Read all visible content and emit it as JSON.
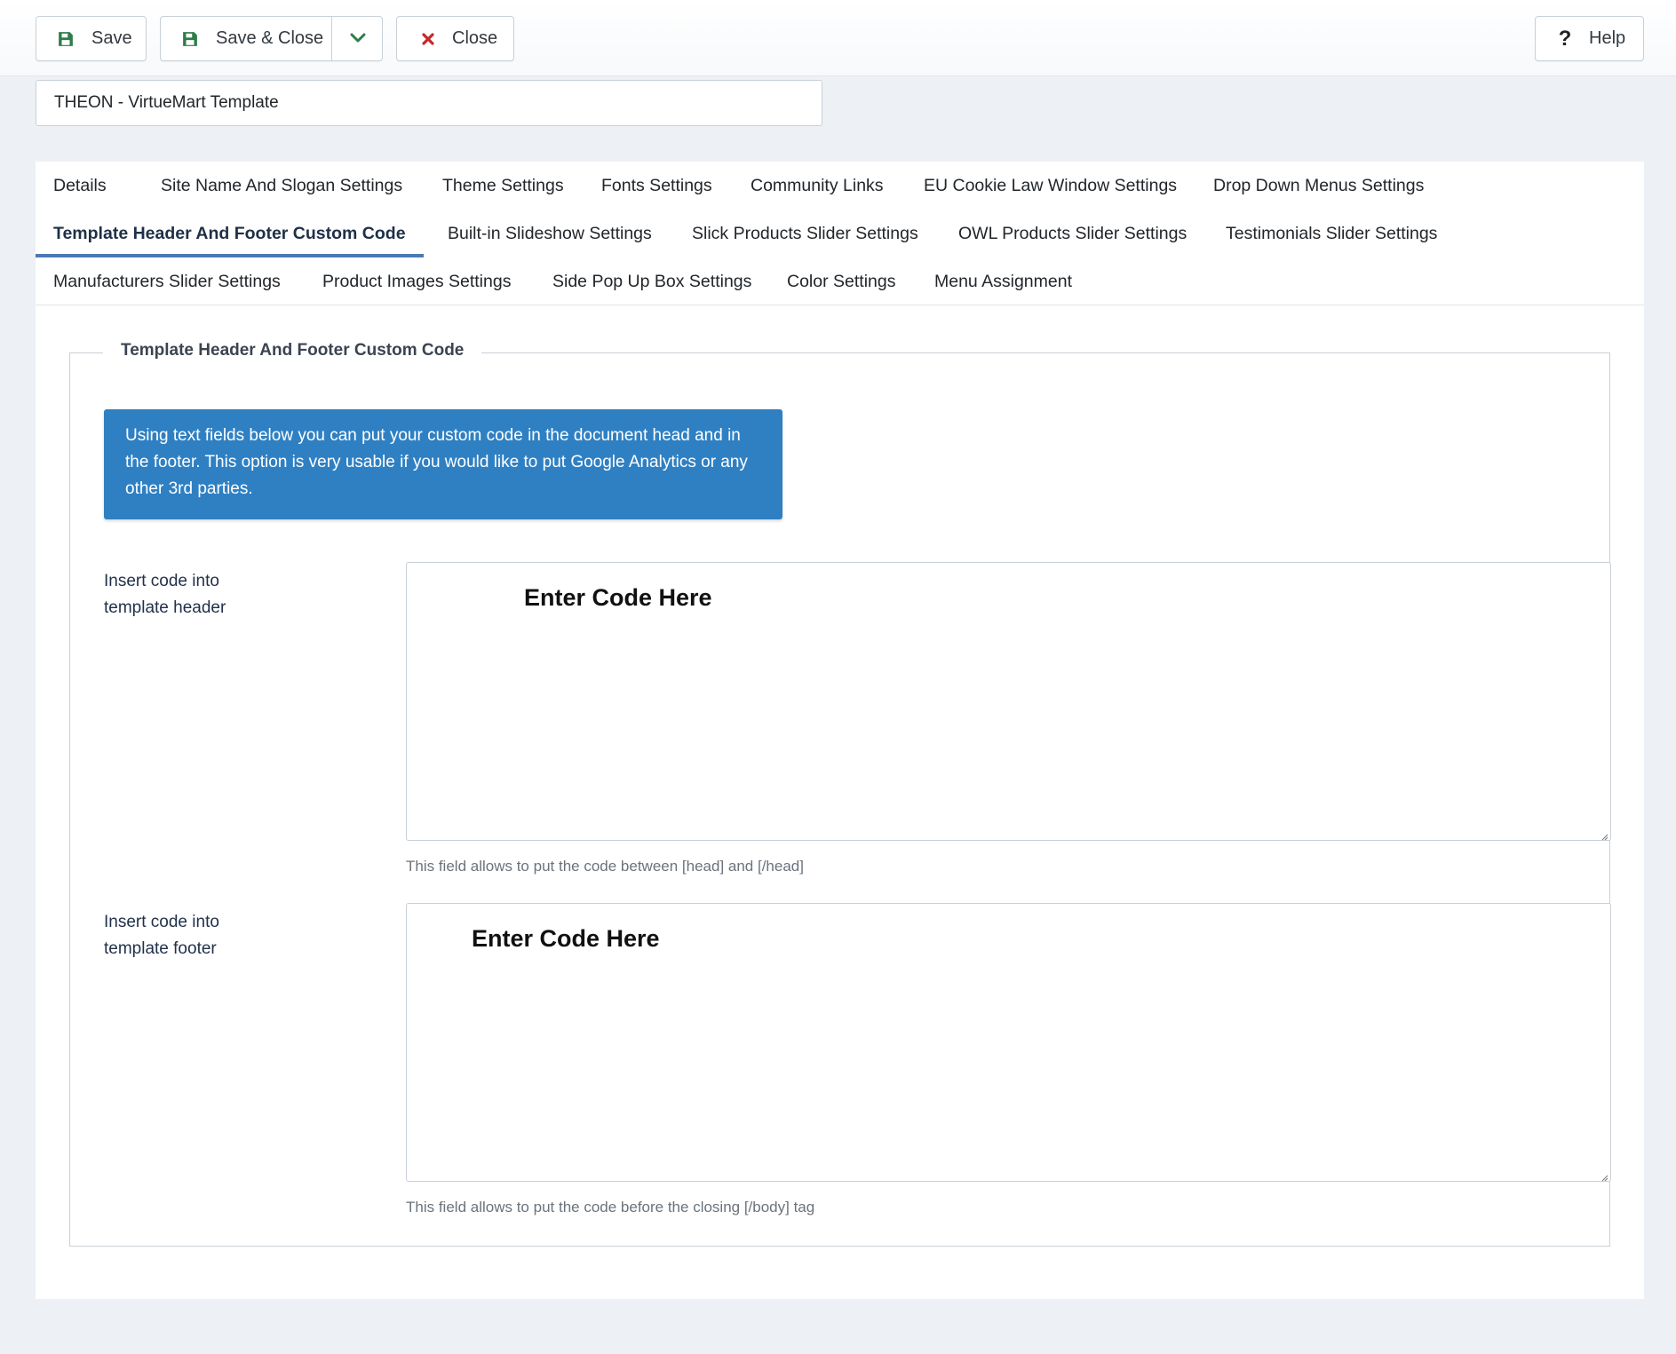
{
  "toolbar": {
    "save_label": "Save",
    "save_close_label": "Save & Close",
    "close_label": "Close",
    "help_label": "Help"
  },
  "title": {
    "value": "THEON - VirtueMart Template"
  },
  "tabs": [
    {
      "label": "Details"
    },
    {
      "label": "Site Name And Slogan Settings"
    },
    {
      "label": "Theme Settings"
    },
    {
      "label": "Fonts Settings"
    },
    {
      "label": "Community Links"
    },
    {
      "label": "EU Cookie Law Window Settings"
    },
    {
      "label": "Drop Down Menus Settings"
    },
    {
      "label": "Template Header And Footer Custom Code"
    },
    {
      "label": "Built-in Slideshow Settings"
    },
    {
      "label": "Slick Products Slider Settings"
    },
    {
      "label": "OWL Products Slider Settings"
    },
    {
      "label": "Testimonials Slider Settings"
    },
    {
      "label": "Manufacturers Slider Settings"
    },
    {
      "label": "Product Images Settings"
    },
    {
      "label": "Side Pop Up Box Settings"
    },
    {
      "label": "Color Settings"
    },
    {
      "label": "Menu Assignment"
    }
  ],
  "active_tab": "Template Header And Footer Custom Code",
  "section": {
    "legend": "Template Header And Footer Custom Code",
    "alert": "Using text fields below you can put your custom code in the document head and in the footer. This option is very usable if you would like to put Google Analytics or any other 3rd parties.",
    "header_field": {
      "label": "Insert code into template header",
      "placeholder": "Enter Code Here",
      "hint": "This field allows to put the code between [head] and [/head]"
    },
    "footer_field": {
      "label": "Insert code into template footer",
      "placeholder": "Enter Code Here",
      "hint": "This field allows to put the code before the closing [/body] tag"
    }
  },
  "colors": {
    "accent": "#4a79b5",
    "alert_bg": "#2f80c3",
    "save_icon": "#2e7d4a",
    "close_icon": "#c62828",
    "page_bg": "#edf1f5"
  },
  "icons": {
    "save": "floppy-disk-icon",
    "save_close": "floppy-disk-icon",
    "dropdown": "chevron-down-icon",
    "close": "x-icon",
    "help": "question-mark-icon"
  }
}
